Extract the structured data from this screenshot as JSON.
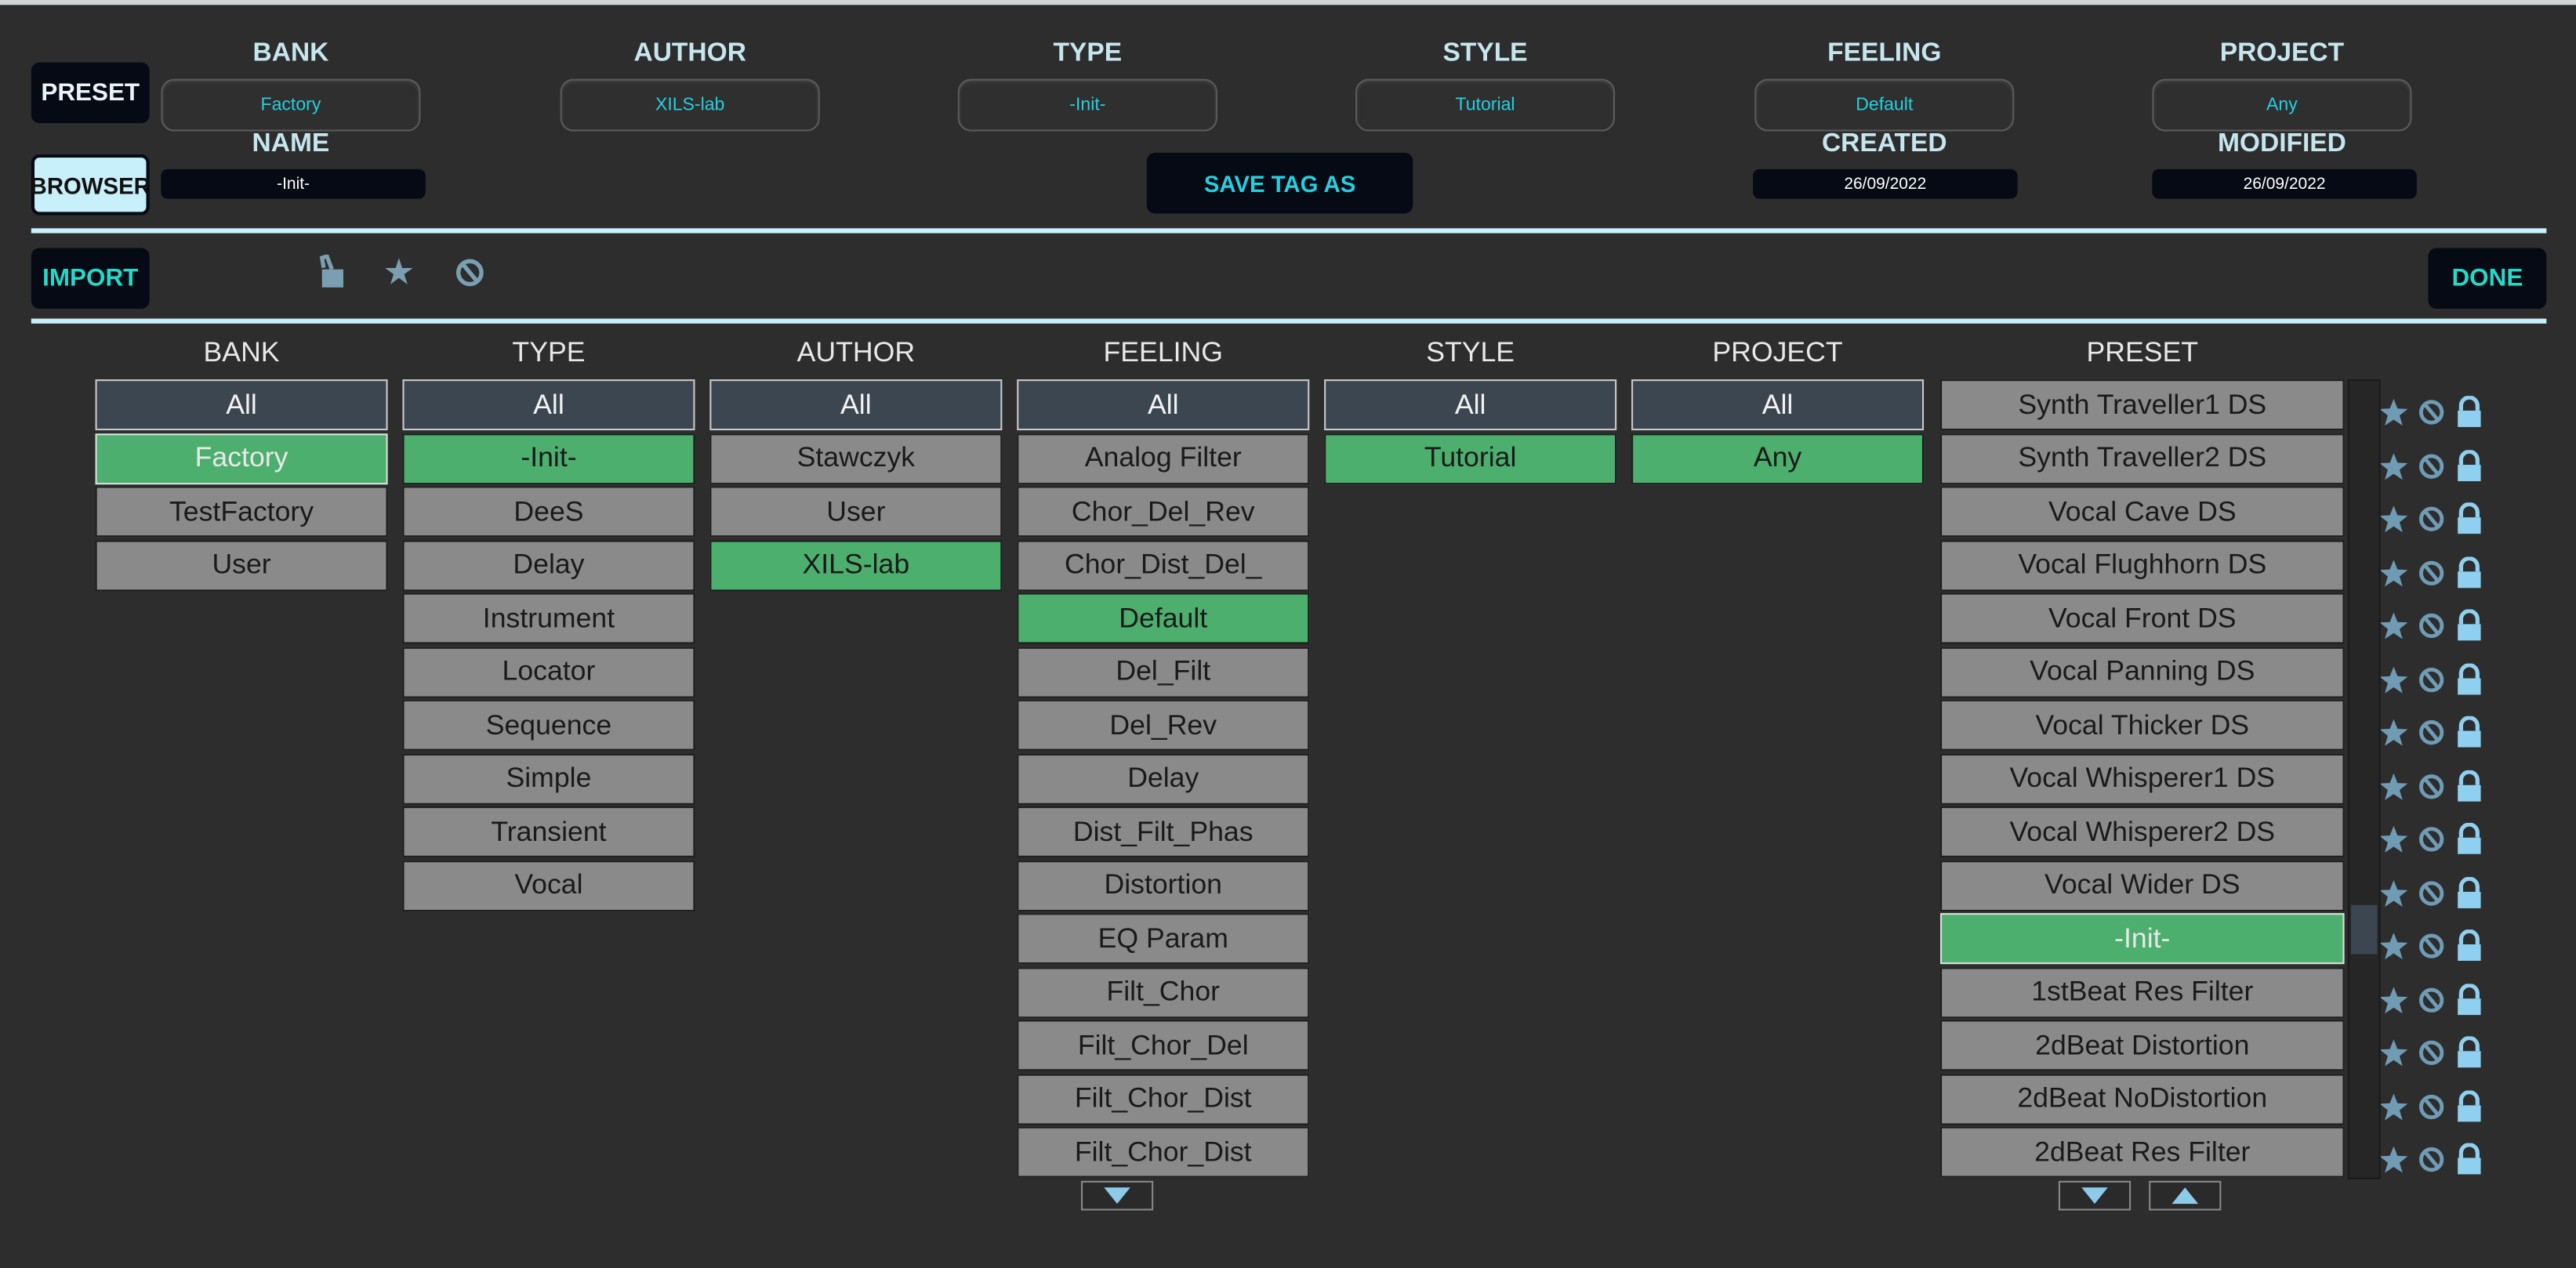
{
  "header": {
    "preset_button": "PRESET",
    "browser_button": "BROWSER",
    "fields": [
      {
        "label": "BANK",
        "value": "Factory"
      },
      {
        "label": "AUTHOR",
        "value": "XILS-lab"
      },
      {
        "label": "TYPE",
        "value": "-Init-"
      },
      {
        "label": "STYLE",
        "value": "Tutorial"
      },
      {
        "label": "FEELING",
        "value": "Default"
      },
      {
        "label": "PROJECT",
        "value": "Any"
      }
    ],
    "name_label": "NAME",
    "name_value": "-Init-",
    "save_tag_as": "SAVE TAG AS",
    "created_label": "CREATED",
    "created_value": "26/09/2022",
    "modified_label": "MODIFIED",
    "modified_value": "26/09/2022"
  },
  "toolbar": {
    "import": "IMPORT",
    "done": "DONE",
    "icons": [
      "unlock-icon",
      "star-icon",
      "ban-icon"
    ]
  },
  "colors": {
    "accent": "#c8f0fa",
    "selected": "#4caf6e",
    "item": "#8a8a8a",
    "all": "#3c4650",
    "cyan_text": "#25cfe0"
  },
  "columns": [
    {
      "title": "BANK",
      "items": [
        "All",
        "Factory",
        "TestFactory",
        "User"
      ],
      "selected": "Factory"
    },
    {
      "title": "TYPE",
      "items": [
        "All",
        "-Init-",
        "DeeS",
        "Delay",
        "Instrument",
        "Locator",
        "Sequence",
        "Simple",
        "Transient",
        "Vocal"
      ],
      "selected": "-Init-"
    },
    {
      "title": "AUTHOR",
      "items": [
        "All",
        "Stawczyk",
        "User",
        "XILS-lab"
      ],
      "selected": "XILS-lab"
    },
    {
      "title": "FEELING",
      "items": [
        "All",
        "Analog Filter",
        "Chor_Del_Rev",
        "Chor_Dist_Del_",
        "Default",
        "Del_Filt",
        "Del_Rev",
        "Delay",
        "Dist_Filt_Phas",
        "Distortion",
        "EQ Param",
        "Filt_Chor",
        "Filt_Chor_Del",
        "Filt_Chor_Dist",
        "Filt_Chor_Dist"
      ],
      "selected": "Default"
    },
    {
      "title": "STYLE",
      "items": [
        "All",
        "Tutorial"
      ],
      "selected": "Tutorial"
    },
    {
      "title": "PROJECT",
      "items": [
        "All",
        "Any"
      ],
      "selected": "Any"
    }
  ],
  "preset_column": {
    "title": "PRESET",
    "items": [
      "Synth Traveller1 DS",
      "Synth Traveller2 DS",
      "Vocal Cave DS",
      "Vocal Flughhorn DS",
      "Vocal Front DS",
      "Vocal Panning DS",
      "Vocal Thicker DS",
      "Vocal Whisperer1 DS",
      "Vocal Whisperer2 DS",
      "Vocal Wider DS",
      "-Init-",
      "1stBeat Res Filter",
      "2dBeat Distortion",
      "2dBeat NoDistortion",
      "2dBeat Res Filter"
    ],
    "selected": "-Init-",
    "row_icons": [
      "star-icon",
      "ban-icon",
      "lock-icon"
    ],
    "scroll_position": 0.7
  }
}
